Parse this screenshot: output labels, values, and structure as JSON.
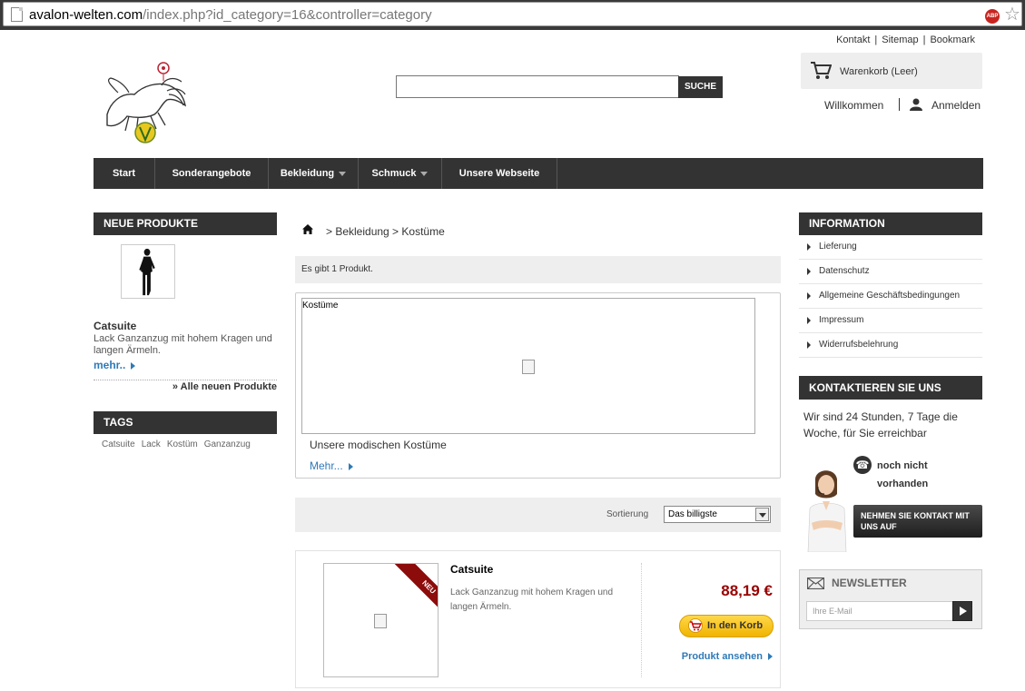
{
  "browser": {
    "url_domain": "avalon-welten.com",
    "url_path": "/index.php?id_category=16&controller=category",
    "adblock_label": "ABP"
  },
  "header": {
    "top_links": [
      "Kontakt",
      "Sitemap",
      "Bookmark"
    ],
    "search_placeholder": "",
    "search_button": "SUCHE",
    "cart_label": "Warenkorb (Leer)",
    "welcome": "Willkommen",
    "login": "Anmelden"
  },
  "nav": {
    "items": [
      {
        "label": "Start"
      },
      {
        "label": "Sonderangebote"
      },
      {
        "label": "Bekleidung"
      },
      {
        "label": "Schmuck"
      },
      {
        "label": "Unsere Webseite"
      }
    ]
  },
  "left": {
    "new_products_title": "NEUE PRODUKTE",
    "new_product": {
      "name": "Catsuite",
      "description": "Lack Ganzanzug mit hohem Kragen und langen Ärmeln.",
      "more": "mehr.."
    },
    "all_new": "» Alle neuen Produkte",
    "tags_title": "TAGS",
    "tags": [
      "Catsuite",
      "Lack",
      "Kostüm",
      "Ganzanzug"
    ]
  },
  "main": {
    "breadcrumb": ">  Bekleidung > Kostüme",
    "product_count": "Es gibt 1 Produkt.",
    "category_image_label": "Kostüme",
    "category_description": "Unsere modischen Kostüme",
    "category_more": "Mehr...",
    "sort_label": "Sortierung",
    "sort_value": "Das billigste",
    "product": {
      "ribbon": "NEU",
      "name": "Catsuite",
      "description": "Lack Ganzanzug mit hohem Kragen und langen Ärmeln.",
      "price": "88,19 €",
      "add_to_cart": "In den Korb",
      "view": "Produkt ansehen"
    }
  },
  "right": {
    "information_title": "INFORMATION",
    "information_items": [
      "Lieferung",
      "Datenschutz",
      "Allgemeine Geschäftsbedingungen",
      "Impressum",
      "Widerrufsbelehrung"
    ],
    "contact_title": "KONTAKTIEREN SIE UNS",
    "contact_text": "Wir sind 24 Stunden, 7 Tage die Woche, für Sie erreichbar",
    "phone_text": "noch nicht vorhanden",
    "contact_button": "NEHMEN SIE KONTAKT MIT UNS AUF",
    "newsletter_title": "NEWSLETTER",
    "newsletter_placeholder": "Ihre E-Mail"
  },
  "colors": {
    "nav_bg": "#333333",
    "link_blue": "#2f7ab8",
    "price_red": "#990000",
    "ribbon_red": "#8c0b0b",
    "cart_button": "#f0b400"
  }
}
